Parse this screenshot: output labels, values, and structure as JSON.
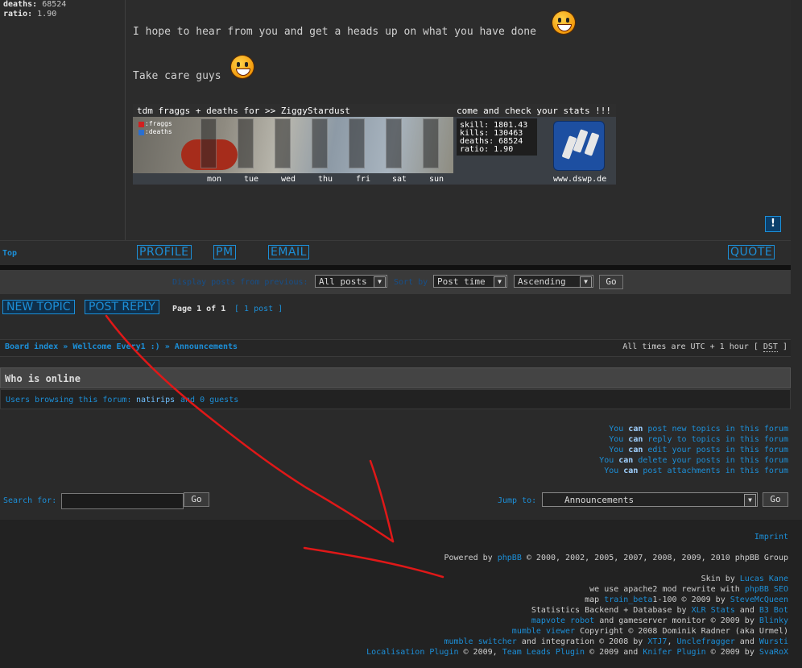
{
  "left_stats": {
    "deaths_label": "deaths:",
    "deaths_value": "68524",
    "ratio_label": "ratio:",
    "ratio_value": "1.90"
  },
  "post": {
    "line1": "I hope to hear from you and get a heads up on what you have done",
    "line2": "Take care guys"
  },
  "banner": {
    "header_left": "tdm fraggs + deaths for >> ZiggyStardust",
    "header_right": "come and check your stats !!!",
    "legend_fraggs": ":fraggs",
    "legend_deaths": ":deaths",
    "days": [
      "mon",
      "tue",
      "wed",
      "thu",
      "fri",
      "sat",
      "sun"
    ],
    "stats": [
      "skill: 1801.43",
      "kills: 130463",
      "deaths: 68524",
      "ratio: 1.90"
    ],
    "site": "www.dswp.de",
    "legend_colors": {
      "fraggs": "#d02020",
      "deaths": "#2a6fd0"
    }
  },
  "post_actions": {
    "top": "Top",
    "profile": "PROFILE",
    "pm": "PM",
    "email": "EMAIL",
    "quote": "QUOTE",
    "report_icon": "!"
  },
  "display": {
    "label": "Display posts from previous:",
    "range": "All posts",
    "sort_label": "Sort by",
    "sort_field": "Post time",
    "sort_dir": "Ascending",
    "go": "Go"
  },
  "topic_bar": {
    "new_topic": "NEW TOPIC",
    "post_reply": "POST REPLY",
    "page_info": "Page 1 of 1",
    "post_count": "[ 1 post ]"
  },
  "breadcrumb": {
    "board_index": "Board index",
    "sep": "»",
    "forum": "Wellcome Every1 :)",
    "sub": "Announcements",
    "times_prefix": "All times are UTC + 1 hour [",
    "dst": "DST",
    "times_suffix": "]"
  },
  "online": {
    "title": "Who is online",
    "browsing": "Users browsing this forum:",
    "user": "natirips",
    "guests": "and 0 guests"
  },
  "permissions": [
    {
      "pre": "You",
      "can": "can",
      "post": "post new topics in this forum"
    },
    {
      "pre": "You",
      "can": "can",
      "post": "reply to topics in this forum"
    },
    {
      "pre": "You",
      "can": "can",
      "post": "edit your posts in this forum"
    },
    {
      "pre": "You",
      "can": "can",
      "post": "delete your posts in this forum"
    },
    {
      "pre": "You",
      "can": "can",
      "post": "post attachments in this forum"
    }
  ],
  "search": {
    "label": "Search for:",
    "go": "Go"
  },
  "jump": {
    "label": "Jump to:",
    "value": "Announcements",
    "go": "Go"
  },
  "footer": {
    "imprint": "Imprint",
    "powered_pre": "Powered by",
    "phpbb": "phpBB",
    "powered_post": "© 2000, 2002, 2005, 2007, 2008, 2009, 2010 phpBB Group",
    "skin_pre": "Skin by",
    "skin_author": "Lucas Kane",
    "seo_pre": "we use apache2 mod rewrite with",
    "seo_link": "phpBB SEO",
    "map_pre": "map",
    "map_link": "train_beta",
    "map_mid": "1-100 © 2009 by",
    "map_author": "SteveMcQueen",
    "stats_pre": "Statistics Backend + Database by",
    "xlr": "XLR Stats",
    "and": "and",
    "b3": "B3 Bot",
    "mapvote": "mapvote robot",
    "mapvote_mid": "and gameserver monitor © 2009 by",
    "blinky": "Blinky",
    "mumble_viewer": "mumble viewer",
    "mumble_viewer_post": "Copyright © 2008 Dominik Radner (aka Urmel)",
    "mumble_switcher": "mumble switcher",
    "switcher_mid": "and integration © 2008 by",
    "xtj7": "XTJ7",
    "comma": ",",
    "unclefragger": "Unclefragger",
    "and2": "and",
    "wursti": "Wursti",
    "loc_plugin": "Localisation Plugin",
    "loc_mid": "© 2009,",
    "team_plugin": "Team Leads Plugin",
    "team_mid": "© 2009 and",
    "knifer_plugin": "Knifer Plugin",
    "knifer_mid": "© 2009 by",
    "svarox": "SvaRoX"
  },
  "colors": {
    "accent": "#1c8fd8",
    "annotation": "#e01818"
  }
}
